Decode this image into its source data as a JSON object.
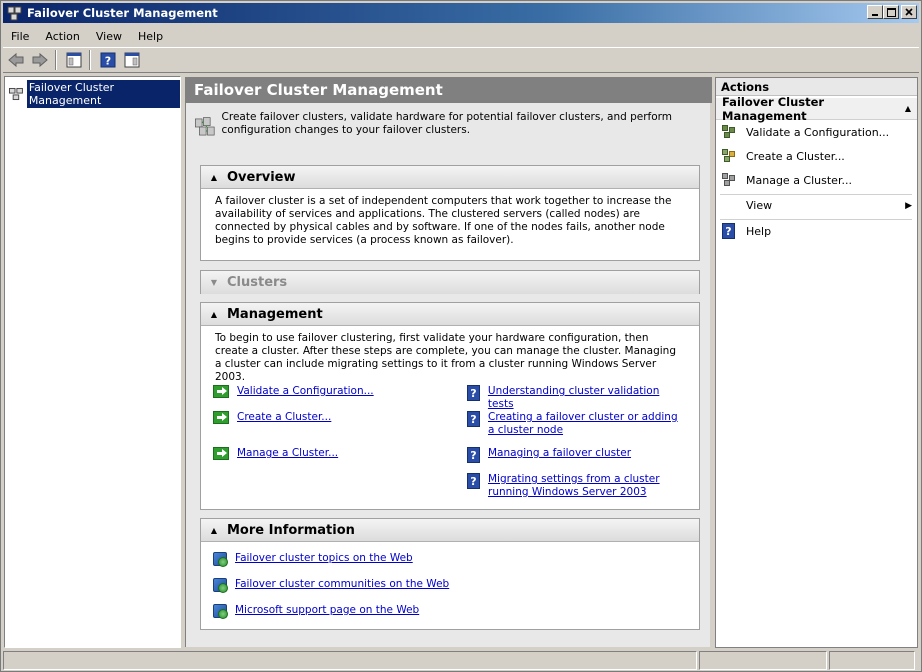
{
  "window": {
    "title": "Failover Cluster Management"
  },
  "menu": [
    "File",
    "Action",
    "View",
    "Help"
  ],
  "tree": {
    "root_label": "Failover Cluster Management"
  },
  "center": {
    "header": "Failover Cluster Management",
    "intro": "Create failover clusters, validate hardware for potential failover clusters, and perform configuration changes to your failover clusters.",
    "overview": {
      "title": "Overview",
      "body": "A failover cluster is a set of independent computers that work together to increase the availability of services and applications. The clustered servers (called nodes) are connected by physical cables and by software. If one of the nodes fails, another node begins to provide services (a process known as failover)."
    },
    "clusters": {
      "title": "Clusters"
    },
    "management": {
      "title": "Management",
      "body": "To begin to use failover clustering, first validate your hardware configuration, then create a cluster. After these steps are complete, you can manage the cluster. Managing a cluster can include migrating settings to it from a cluster running Windows Server 2003.",
      "actions": [
        "Validate a Configuration...",
        "Create a Cluster...",
        "Manage a Cluster..."
      ],
      "help_links": [
        "Understanding cluster validation tests",
        "Creating a failover cluster or adding a cluster node",
        "Managing a failover cluster",
        "Migrating settings from a cluster running Windows Server 2003"
      ]
    },
    "more_info": {
      "title": "More Information",
      "links": [
        "Failover cluster topics on the Web",
        "Failover cluster communities on the Web",
        "Microsoft support page on the Web"
      ]
    }
  },
  "actions_pane": {
    "header": "Actions",
    "group_title": "Failover Cluster Management",
    "items": [
      "Validate a Configuration...",
      "Create a Cluster...",
      "Manage a Cluster...",
      "View",
      "Help"
    ]
  },
  "colors": {
    "title_bar": "#0a246a",
    "link": "#0000cc",
    "selection": "#0a246a",
    "center_header": "#808080"
  }
}
